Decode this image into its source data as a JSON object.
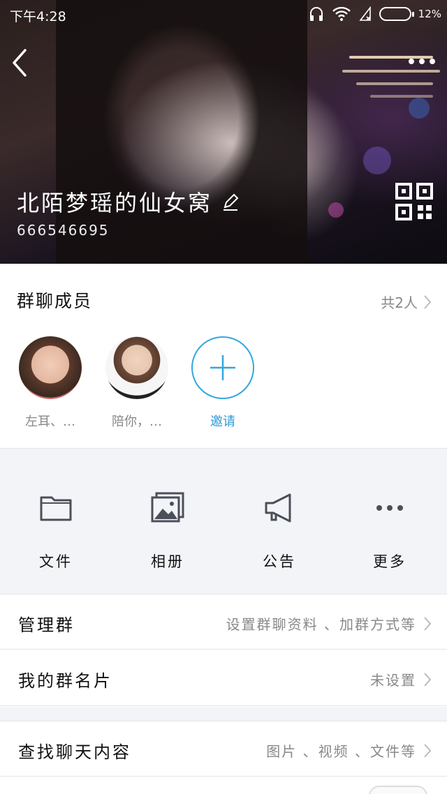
{
  "status_bar": {
    "time": "下午4:28",
    "battery": "12%"
  },
  "group": {
    "name": "北陌梦瑶的仙女窝",
    "id": "666546695"
  },
  "members": {
    "header": "群聊成员",
    "count_label": "共2人",
    "list": [
      {
        "name": "左耳、…"
      },
      {
        "name": "陪你，…"
      }
    ],
    "invite_label": "邀请"
  },
  "actions": [
    {
      "label": "文件",
      "icon": "folder-icon"
    },
    {
      "label": "相册",
      "icon": "photo-album-icon"
    },
    {
      "label": "公告",
      "icon": "megaphone-icon"
    },
    {
      "label": "更多",
      "icon": "more-dots-icon"
    }
  ],
  "rows": {
    "manage": {
      "title": "管理群",
      "value": "设置群聊资料 、加群方式等"
    },
    "card": {
      "title": "我的群名片",
      "value": "未设置"
    },
    "search": {
      "title": "查找聊天内容",
      "value": "图片 、视频 、文件等"
    }
  },
  "colors": {
    "accent": "#33a7df",
    "icon_gray": "#4a4f5a",
    "background": "#f3f4f7"
  }
}
